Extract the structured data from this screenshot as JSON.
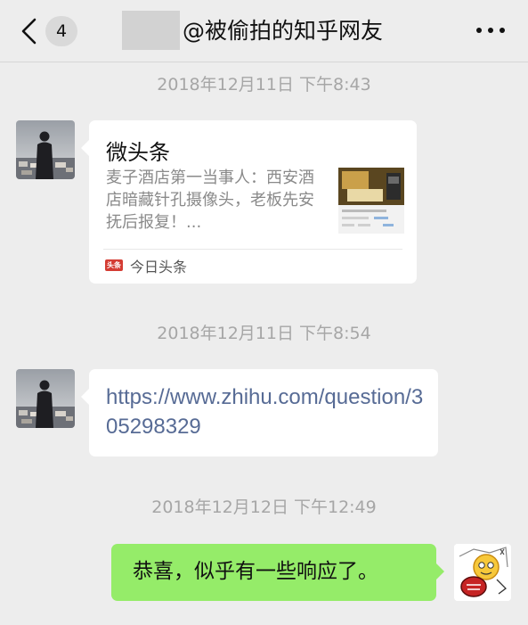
{
  "header": {
    "unread_count": "4",
    "title": "@被偷拍的知乎网友"
  },
  "messages": [
    {
      "timestamp": "2018年12月11日 下午8:43",
      "type": "article-card",
      "card": {
        "title": "微头条",
        "description": "麦子酒店第一当事人：西安酒店暗藏针孔摄像头，老板先安抚后报复！...",
        "source_logo_text": "头条",
        "source_name": "今日头条"
      }
    },
    {
      "timestamp": "2018年12月11日 下午8:54",
      "type": "link",
      "text": "https://www.zhihu.com/question/305298329"
    },
    {
      "timestamp": "2018年12月12日 下午12:49",
      "type": "text",
      "direction": "outgoing",
      "text": "恭喜，似乎有一些响应了。"
    }
  ],
  "colors": {
    "background": "#ededed",
    "outgoing_bubble": "#95ec69",
    "incoming_bubble": "#ffffff",
    "link": "#576b95",
    "timestamp": "#a6a6a6"
  },
  "icons": [
    "back-chevron-icon",
    "more-dots-icon",
    "toutiao-logo-icon"
  ]
}
